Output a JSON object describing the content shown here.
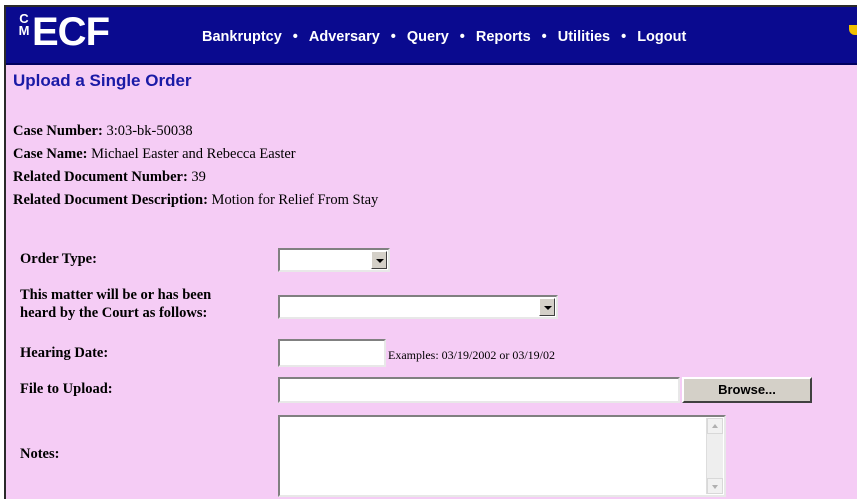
{
  "logo": {
    "cm": "CM",
    "ecf": "ECF"
  },
  "menu": {
    "items": [
      "Bankruptcy",
      "Adversary",
      "Query",
      "Reports",
      "Utilities",
      "Logout"
    ],
    "separator": "•"
  },
  "page_title": "Upload a Single Order",
  "case": {
    "number_label": "Case Number:",
    "number": "3:03-bk-50038",
    "name_label": "Case Name:",
    "name": "Michael Easter and Rebecca Easter",
    "doc_number_label": "Related Document Number:",
    "doc_number": "39",
    "doc_desc_label": "Related Document Description:",
    "doc_desc": "Motion for Relief From Stay"
  },
  "form": {
    "order_type_label": "Order Type:",
    "order_type_value": "",
    "heard_label_line1": "This matter will be or has been",
    "heard_label_line2": "heard by the Court as follows:",
    "heard_value": "",
    "hearing_date_label": "Hearing Date:",
    "hearing_date_value": "",
    "hearing_date_hint": "Examples: 03/19/2002 or 03/19/02",
    "file_label": "File to Upload:",
    "file_value": "",
    "browse_label": "Browse...",
    "notes_label": "Notes:",
    "notes_value": ""
  },
  "colors": {
    "page_bg": "#f5ccf5",
    "header_bg": "#0a0a8f",
    "title_color": "#1a1aa6"
  }
}
